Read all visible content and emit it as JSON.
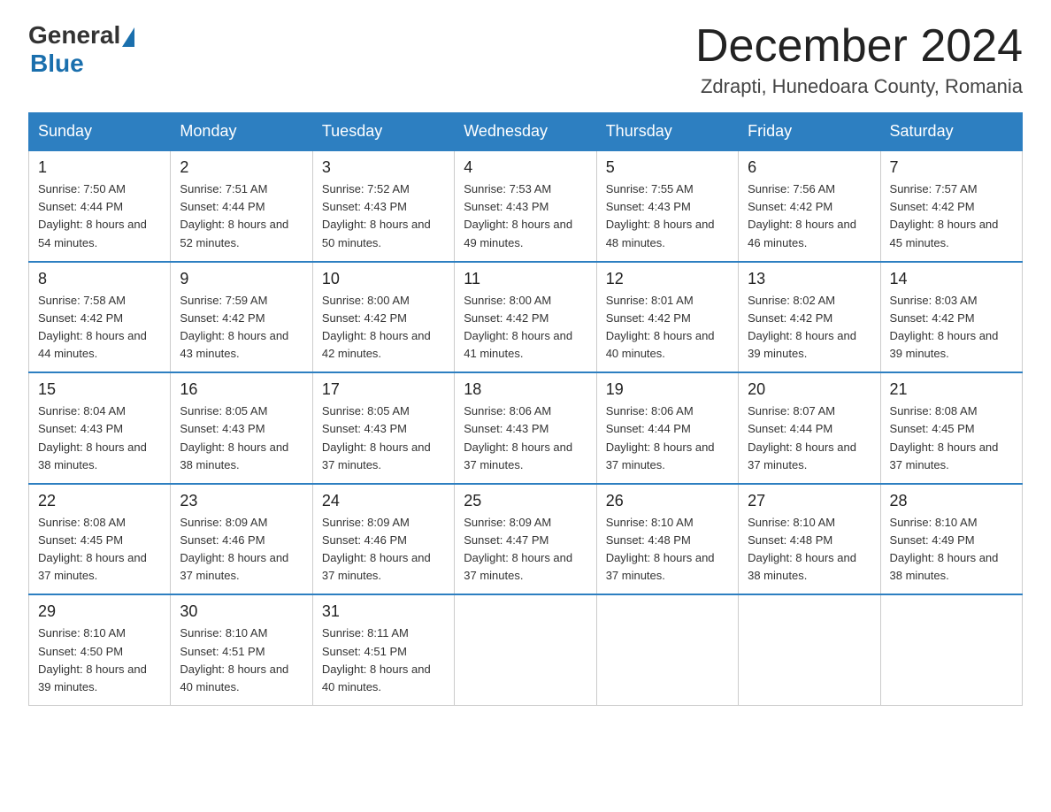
{
  "header": {
    "logo_general": "General",
    "logo_blue": "Blue",
    "month_title": "December 2024",
    "location": "Zdrapti, Hunedoara County, Romania"
  },
  "weekdays": [
    "Sunday",
    "Monday",
    "Tuesday",
    "Wednesday",
    "Thursday",
    "Friday",
    "Saturday"
  ],
  "weeks": [
    [
      {
        "day": "1",
        "sunrise": "7:50 AM",
        "sunset": "4:44 PM",
        "daylight": "8 hours and 54 minutes."
      },
      {
        "day": "2",
        "sunrise": "7:51 AM",
        "sunset": "4:44 PM",
        "daylight": "8 hours and 52 minutes."
      },
      {
        "day": "3",
        "sunrise": "7:52 AM",
        "sunset": "4:43 PM",
        "daylight": "8 hours and 50 minutes."
      },
      {
        "day": "4",
        "sunrise": "7:53 AM",
        "sunset": "4:43 PM",
        "daylight": "8 hours and 49 minutes."
      },
      {
        "day": "5",
        "sunrise": "7:55 AM",
        "sunset": "4:43 PM",
        "daylight": "8 hours and 48 minutes."
      },
      {
        "day": "6",
        "sunrise": "7:56 AM",
        "sunset": "4:42 PM",
        "daylight": "8 hours and 46 minutes."
      },
      {
        "day": "7",
        "sunrise": "7:57 AM",
        "sunset": "4:42 PM",
        "daylight": "8 hours and 45 minutes."
      }
    ],
    [
      {
        "day": "8",
        "sunrise": "7:58 AM",
        "sunset": "4:42 PM",
        "daylight": "8 hours and 44 minutes."
      },
      {
        "day": "9",
        "sunrise": "7:59 AM",
        "sunset": "4:42 PM",
        "daylight": "8 hours and 43 minutes."
      },
      {
        "day": "10",
        "sunrise": "8:00 AM",
        "sunset": "4:42 PM",
        "daylight": "8 hours and 42 minutes."
      },
      {
        "day": "11",
        "sunrise": "8:00 AM",
        "sunset": "4:42 PM",
        "daylight": "8 hours and 41 minutes."
      },
      {
        "day": "12",
        "sunrise": "8:01 AM",
        "sunset": "4:42 PM",
        "daylight": "8 hours and 40 minutes."
      },
      {
        "day": "13",
        "sunrise": "8:02 AM",
        "sunset": "4:42 PM",
        "daylight": "8 hours and 39 minutes."
      },
      {
        "day": "14",
        "sunrise": "8:03 AM",
        "sunset": "4:42 PM",
        "daylight": "8 hours and 39 minutes."
      }
    ],
    [
      {
        "day": "15",
        "sunrise": "8:04 AM",
        "sunset": "4:43 PM",
        "daylight": "8 hours and 38 minutes."
      },
      {
        "day": "16",
        "sunrise": "8:05 AM",
        "sunset": "4:43 PM",
        "daylight": "8 hours and 38 minutes."
      },
      {
        "day": "17",
        "sunrise": "8:05 AM",
        "sunset": "4:43 PM",
        "daylight": "8 hours and 37 minutes."
      },
      {
        "day": "18",
        "sunrise": "8:06 AM",
        "sunset": "4:43 PM",
        "daylight": "8 hours and 37 minutes."
      },
      {
        "day": "19",
        "sunrise": "8:06 AM",
        "sunset": "4:44 PM",
        "daylight": "8 hours and 37 minutes."
      },
      {
        "day": "20",
        "sunrise": "8:07 AM",
        "sunset": "4:44 PM",
        "daylight": "8 hours and 37 minutes."
      },
      {
        "day": "21",
        "sunrise": "8:08 AM",
        "sunset": "4:45 PM",
        "daylight": "8 hours and 37 minutes."
      }
    ],
    [
      {
        "day": "22",
        "sunrise": "8:08 AM",
        "sunset": "4:45 PM",
        "daylight": "8 hours and 37 minutes."
      },
      {
        "day": "23",
        "sunrise": "8:09 AM",
        "sunset": "4:46 PM",
        "daylight": "8 hours and 37 minutes."
      },
      {
        "day": "24",
        "sunrise": "8:09 AM",
        "sunset": "4:46 PM",
        "daylight": "8 hours and 37 minutes."
      },
      {
        "day": "25",
        "sunrise": "8:09 AM",
        "sunset": "4:47 PM",
        "daylight": "8 hours and 37 minutes."
      },
      {
        "day": "26",
        "sunrise": "8:10 AM",
        "sunset": "4:48 PM",
        "daylight": "8 hours and 37 minutes."
      },
      {
        "day": "27",
        "sunrise": "8:10 AM",
        "sunset": "4:48 PM",
        "daylight": "8 hours and 38 minutes."
      },
      {
        "day": "28",
        "sunrise": "8:10 AM",
        "sunset": "4:49 PM",
        "daylight": "8 hours and 38 minutes."
      }
    ],
    [
      {
        "day": "29",
        "sunrise": "8:10 AM",
        "sunset": "4:50 PM",
        "daylight": "8 hours and 39 minutes."
      },
      {
        "day": "30",
        "sunrise": "8:10 AM",
        "sunset": "4:51 PM",
        "daylight": "8 hours and 40 minutes."
      },
      {
        "day": "31",
        "sunrise": "8:11 AM",
        "sunset": "4:51 PM",
        "daylight": "8 hours and 40 minutes."
      },
      null,
      null,
      null,
      null
    ]
  ]
}
